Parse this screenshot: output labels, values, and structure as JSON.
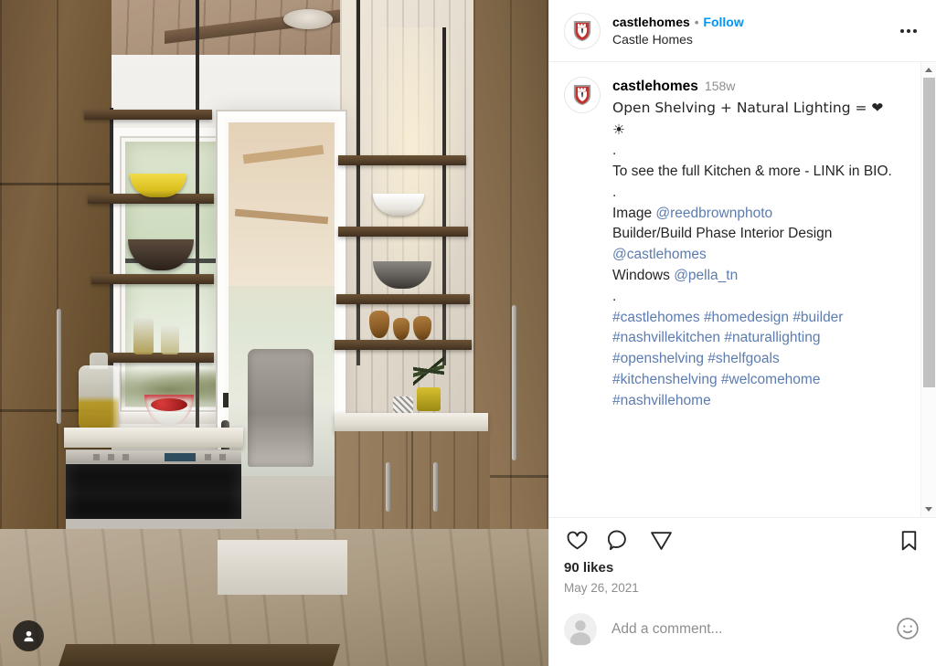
{
  "header": {
    "username": "castlehomes",
    "separator": "•",
    "follow_label": "Follow",
    "subtitle": "Castle Homes",
    "more_icon": "ellipsis-icon",
    "avatar_icon": "castle-shield-avatar"
  },
  "caption": {
    "username": "castlehomes",
    "timestamp": "158w",
    "line1": "Open Shelving + Natural Lighting = ❤",
    "line2": "☀",
    "line3": ".",
    "line4": "To see the full Kitchen & more - LINK in BIO.",
    "line5": ".",
    "image_label": "Image ",
    "image_credit": "@reedbrownphoto",
    "builder_label": "Builder/Build Phase Interior Design",
    "builder_credit": "@castlehomes",
    "windows_label": "Windows ",
    "windows_credit": "@pella_tn",
    "line6": ".",
    "hashtags_line1": "#castlehomes #homedesign #builder",
    "hashtags_line2": "#nashvillekitchen #naturallighting",
    "hashtags_line3": "#openshelving #shelfgoals",
    "hashtags_line4": "#kitchenshelving #welcomehome",
    "hashtags_line5": "#nashvillehome"
  },
  "actions": {
    "like_icon": "heart-icon",
    "comment_icon": "speech-bubble-icon",
    "share_icon": "paper-plane-icon",
    "save_icon": "bookmark-icon"
  },
  "stats": {
    "likes": "90 likes",
    "date": "May 26, 2021"
  },
  "comment_bar": {
    "avatar_icon": "default-user-avatar",
    "placeholder": "Add a comment...",
    "emoji_icon": "smiley-face-icon"
  },
  "media": {
    "tag_badge_icon": "person-tag-icon",
    "alt": "Kitchen interior with suspended open wood shelving in front of a window, wood cabinetry, marble countertop, stainless microwave drawer and a glass door leading to a covered porch"
  },
  "scrollbar": {
    "up_icon": "scroll-up-arrow-icon",
    "down_icon": "scroll-down-arrow-icon",
    "thumb": "scroll-thumb"
  },
  "colors": {
    "link_blue": "#0095f6",
    "caption_link": "#5c7cb0",
    "text_primary": "#262626",
    "text_muted": "#8e8e8e",
    "shield_red": "#c4302b"
  }
}
